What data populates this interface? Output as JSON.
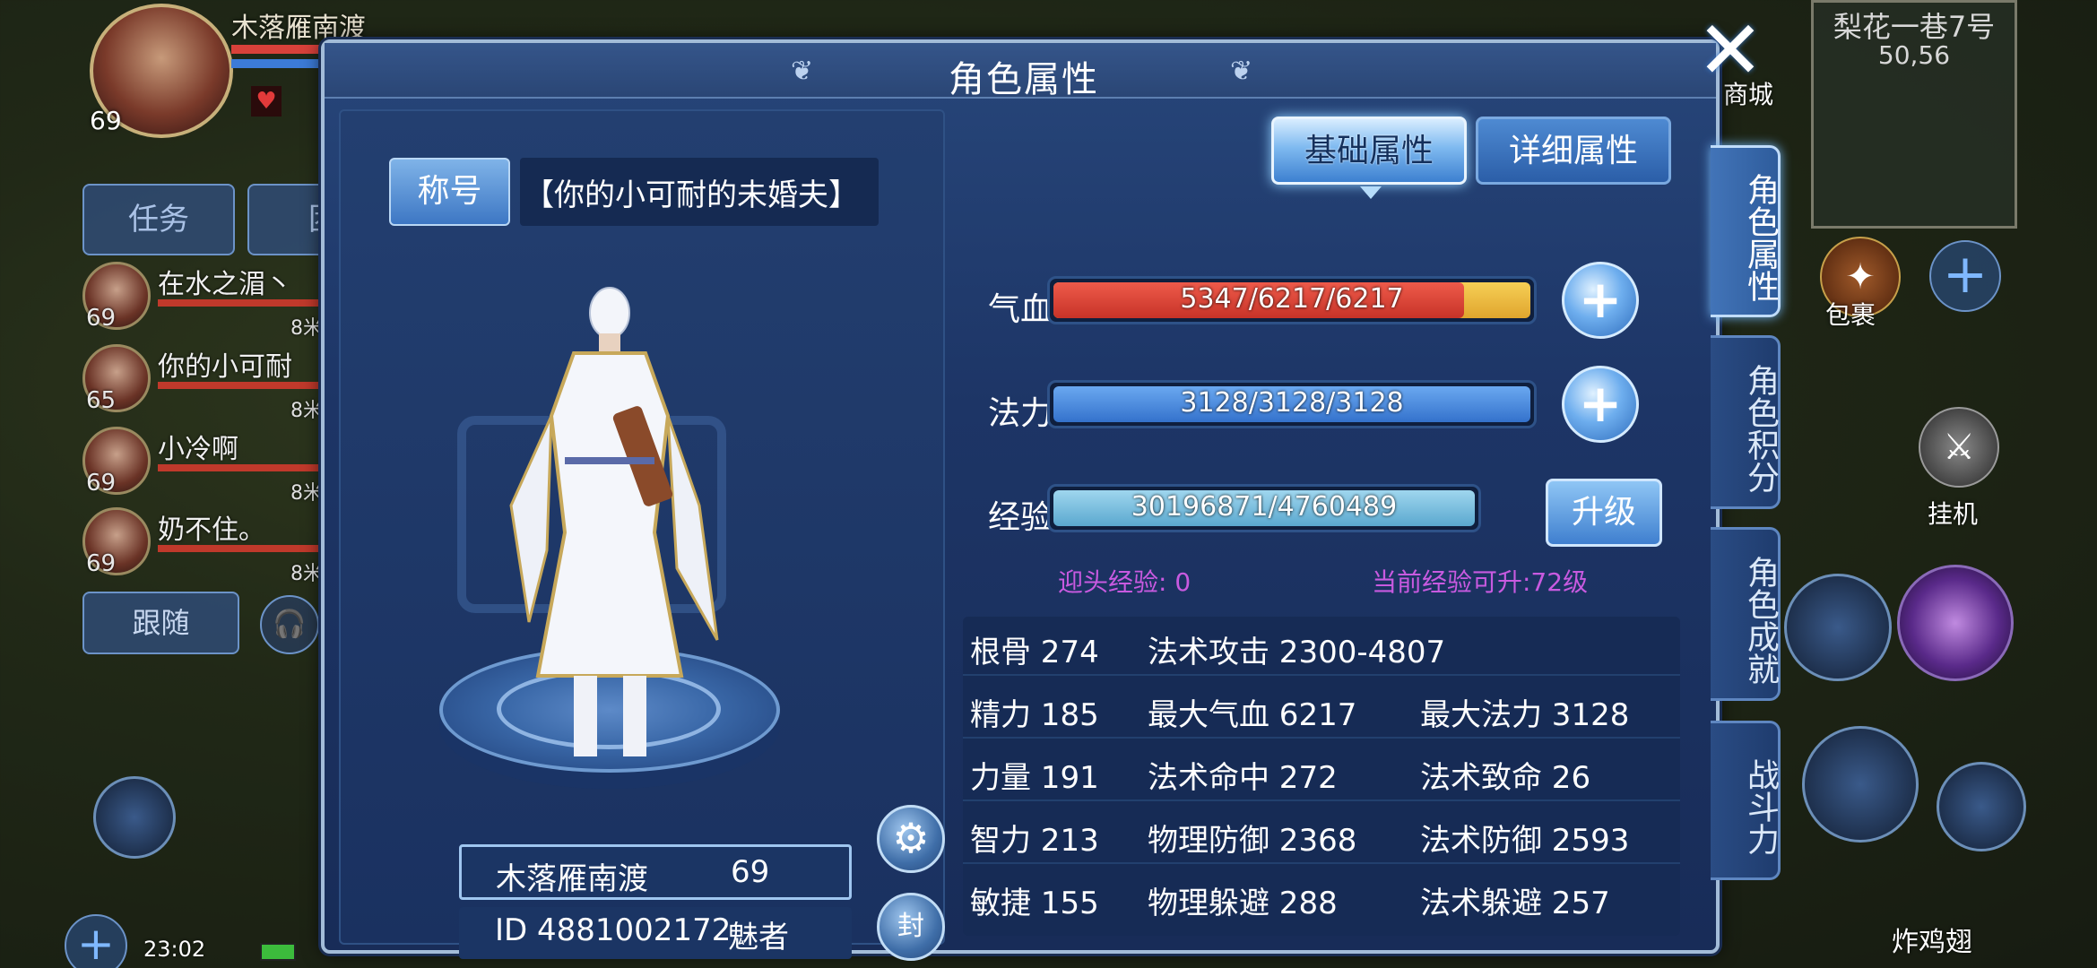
{
  "hud": {
    "player_name": "木落雁南渡",
    "player_level": "69",
    "tabs": [
      "任务",
      "团"
    ],
    "team": [
      {
        "name": "在水之湄丶",
        "level": "69",
        "dist": "8米"
      },
      {
        "name": "你的小可耐",
        "level": "65",
        "dist": "8米"
      },
      {
        "name": "小冷啊",
        "level": "69",
        "dist": "8米"
      },
      {
        "name": "奶不住。",
        "level": "69",
        "dist": "8米"
      }
    ],
    "follow_label": "跟随",
    "time": "23:02",
    "location_name": "梨花一巷7号",
    "location_coord": "50,56",
    "shop_label": "商城",
    "bag_label": "包裹",
    "auto_label": "挂机",
    "chicken_label": "炸鸡翅"
  },
  "panel": {
    "title": "角色属性",
    "title_button": "称号",
    "title_text": "【你的小可耐的未婚夫】",
    "char_name": "木落雁南渡",
    "char_level": "69",
    "char_id": "ID 4881002172",
    "char_class": "魅者",
    "seal_label": "封"
  },
  "tabs": {
    "basic": "基础属性",
    "detail": "详细属性"
  },
  "stats": {
    "hp_label": "气血",
    "hp_text": "5347/6217/6217",
    "hp_fill": 0.86,
    "mp_label": "法力",
    "mp_text": "3128/3128/3128",
    "mp_fill": 1.0,
    "exp_label": "经验",
    "exp_text": "30196871/4760489",
    "exp_fill": 1.0,
    "upgrade_label": "升级",
    "welcome_exp": "迎头经验: 0",
    "can_upgrade": "当前经验可升:72级"
  },
  "attributes": [
    [
      "根骨 274",
      "法术攻击 2300-4807",
      ""
    ],
    [
      "精力 185",
      "最大气血 6217",
      "最大法力 3128"
    ],
    [
      "力量 191",
      "法术命中 272",
      "法术致命 26"
    ],
    [
      "智力 213",
      "物理防御 2368",
      "法术防御 2593"
    ],
    [
      "敏捷 155",
      "物理躲避 288",
      "法术躲避 257"
    ]
  ],
  "side_tabs": [
    "角色属性",
    "角色积分",
    "角色成就",
    "战斗力"
  ],
  "colors": {
    "hp": "#d8413a",
    "hp_secondary": "#e9b43a",
    "mp": "#4a8ae0",
    "exp": "#7fc0e0",
    "note": "#c85ae0"
  }
}
